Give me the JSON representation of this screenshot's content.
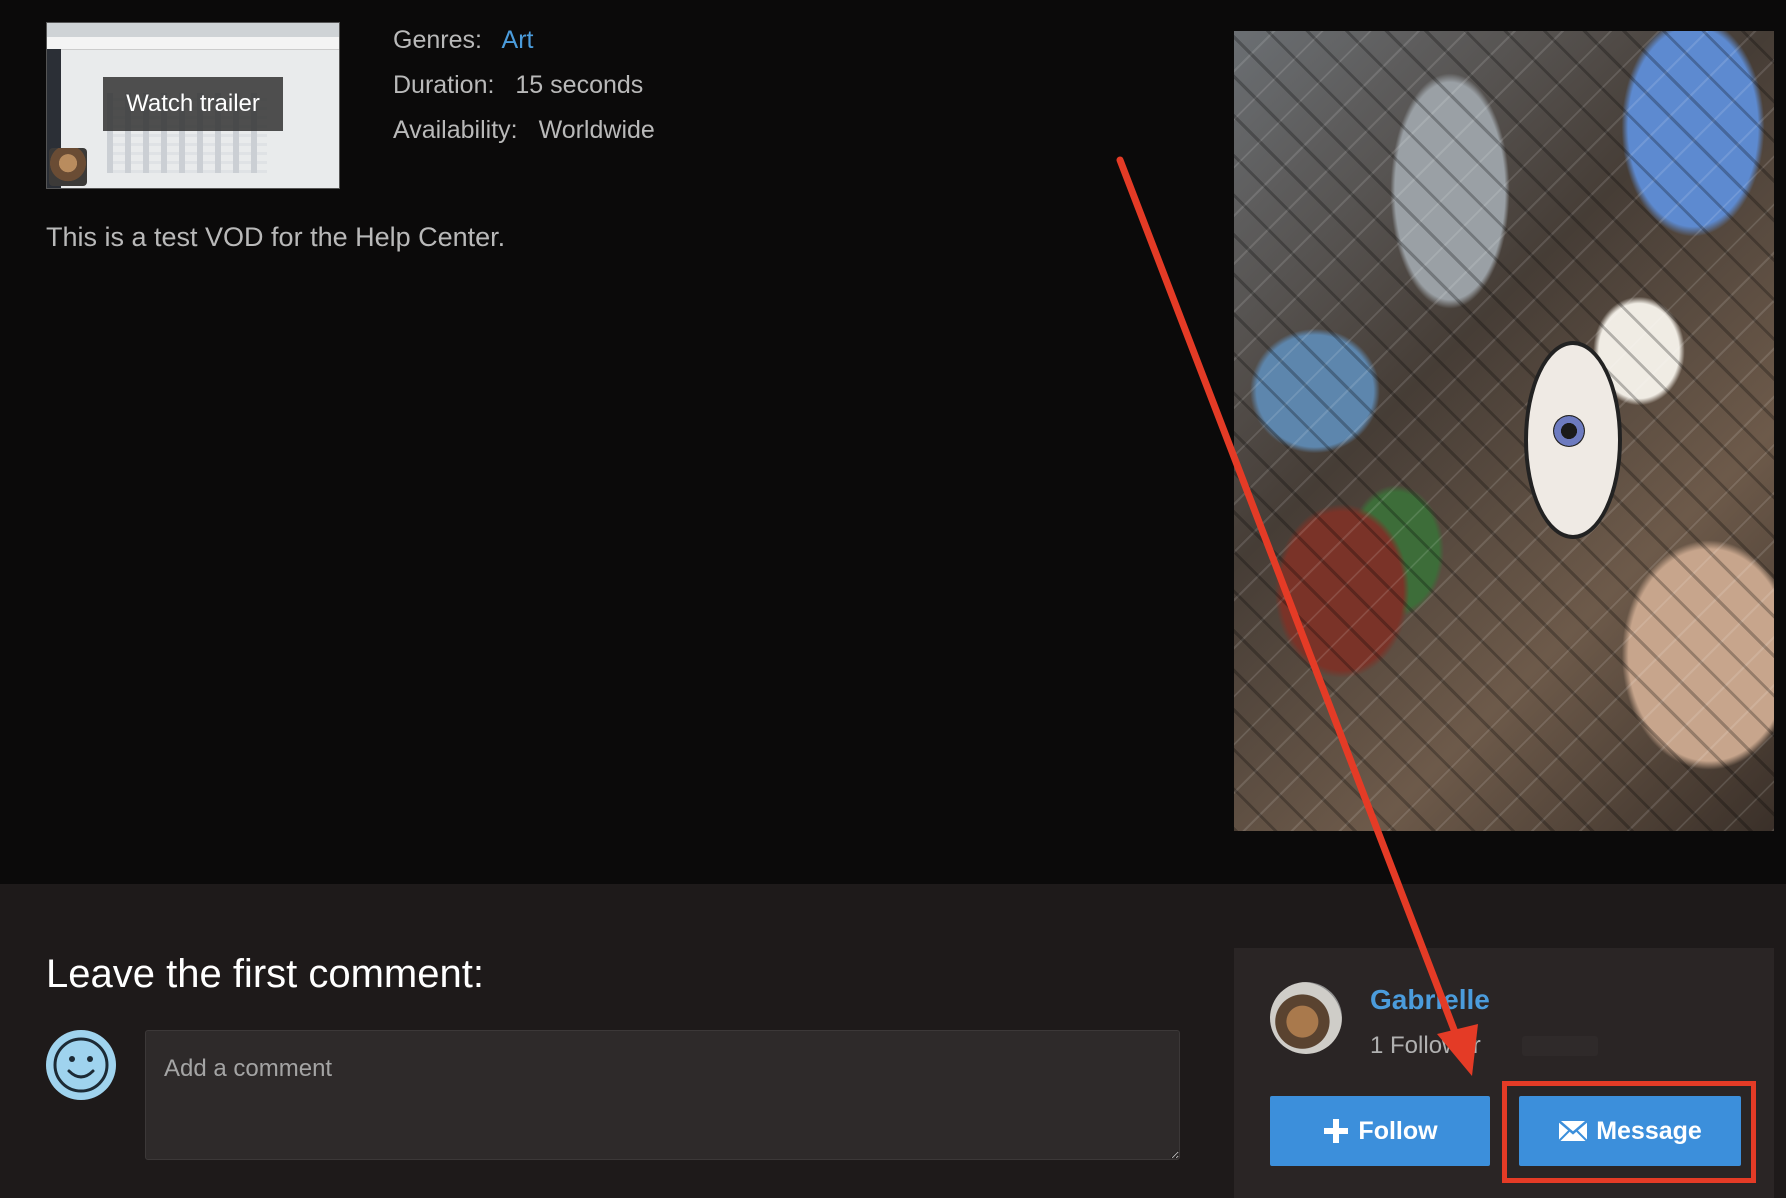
{
  "trailer": {
    "button_label": "Watch trailer"
  },
  "meta": {
    "genres_label": "Genres:",
    "genres_value": "Art",
    "duration_label": "Duration:",
    "duration_value": "15 seconds",
    "availability_label": "Availability:",
    "availability_value": "Worldwide"
  },
  "description": "This is a test VOD for the Help Center.",
  "comments": {
    "title": "Leave the first comment:",
    "placeholder": "Add a comment"
  },
  "creator": {
    "name": "Gabrielle",
    "followers": "1 Follower",
    "follow_label": "Follow",
    "message_label": "Message"
  },
  "colors": {
    "link": "#4b9cdc",
    "button": "#3c8fdb",
    "annotation": "#e43b26"
  }
}
